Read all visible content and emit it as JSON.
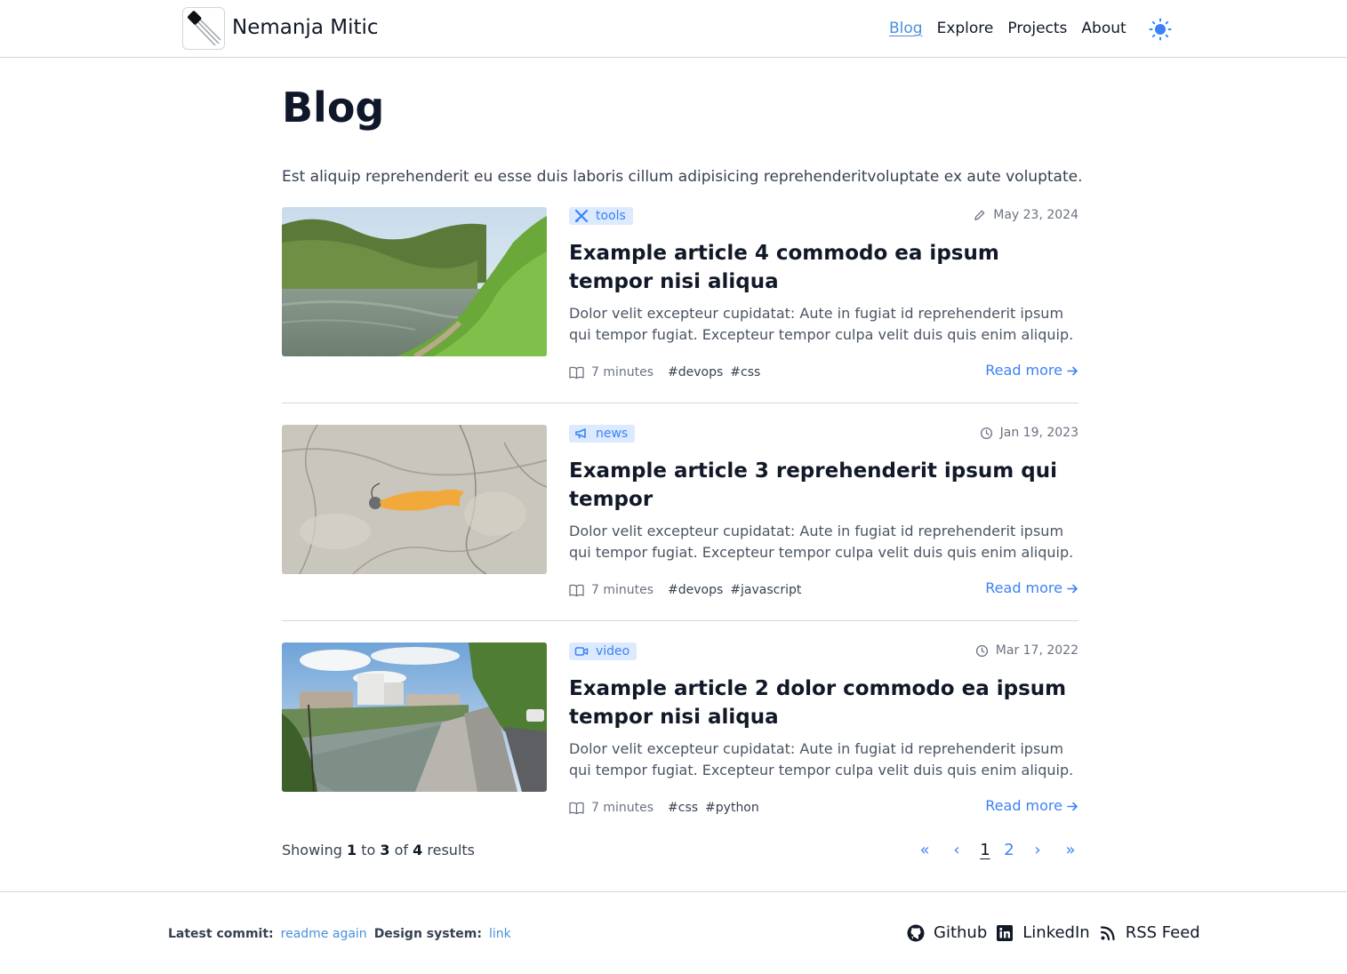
{
  "header": {
    "site_title": "Nemanja Mitic",
    "nav": [
      {
        "label": "Blog",
        "active": true
      },
      {
        "label": "Explore",
        "active": false
      },
      {
        "label": "Projects",
        "active": false
      },
      {
        "label": "About",
        "active": false
      }
    ],
    "theme_icon": "sun-icon",
    "logo_icon": "transistor-logo-icon"
  },
  "main": {
    "title": "Blog",
    "intro": "Est aliquip reprehenderit eu esse duis laboris cillum adipisicing reprehenderitvoluptate ex aute voluptate.",
    "read_more_label": "Read more",
    "articles": [
      {
        "category": "tools",
        "category_icon": "tools-icon",
        "date": "May 23, 2024",
        "date_icon": "pencil-icon",
        "title": "Example article 4 commodo ea ipsum tempor nisi aliqua",
        "excerpt": "Dolor velit excepteur cupidatat: Aute in fugiat id reprehenderit ipsum qui tempor fugiat. Excepteur tempor culpa velit duis quis enim aliquip.",
        "read_time": "7 minutes",
        "tags": [
          "#devops",
          "#css"
        ],
        "thumbnail": "river-landscape"
      },
      {
        "category": "news",
        "category_icon": "megaphone-icon",
        "date": "Jan 19, 2023",
        "date_icon": "clock-icon",
        "title": "Example article 3 reprehenderit ipsum qui tempor",
        "excerpt": "Dolor velit excepteur cupidatat: Aute in fugiat id reprehenderit ipsum qui tempor fugiat. Excepteur tempor culpa velit duis quis enim aliquip.",
        "read_time": "7 minutes",
        "tags": [
          "#devops",
          "#javascript"
        ],
        "thumbnail": "fishing-lure-on-rock"
      },
      {
        "category": "video",
        "category_icon": "video-icon",
        "date": "Mar 17, 2022",
        "date_icon": "clock-icon",
        "title": "Example article 2 dolor commodo ea ipsum tempor nisi aliqua",
        "excerpt": "Dolor velit excepteur cupidatat: Aute in fugiat id reprehenderit ipsum qui tempor fugiat. Excepteur tempor culpa velit duis quis enim aliquip.",
        "read_time": "7 minutes",
        "tags": [
          "#css",
          "#python"
        ],
        "thumbnail": "city-riverbank"
      }
    ]
  },
  "pagination": {
    "showing_prefix": "Showing",
    "from": "1",
    "to_word": "to",
    "to": "3",
    "of_word": "of",
    "total": "4",
    "results_word": "results",
    "first": "«",
    "prev": "‹",
    "pages": [
      "1",
      "2"
    ],
    "current_page": "1",
    "next": "›",
    "last": "»"
  },
  "footer": {
    "commit_label": "Latest commit:",
    "commit_link": "readme again",
    "design_label": "Design system:",
    "design_link": "link",
    "socials": [
      {
        "label": "Github",
        "icon": "github-icon"
      },
      {
        "label": "LinkedIn",
        "icon": "linkedin-icon"
      },
      {
        "label": "RSS Feed",
        "icon": "rss-icon"
      }
    ]
  },
  "colors": {
    "accent": "#3b82f6",
    "badge_bg": "#dbeafe",
    "border": "#d1d5db",
    "text": "#111827",
    "muted": "#6b7280"
  }
}
